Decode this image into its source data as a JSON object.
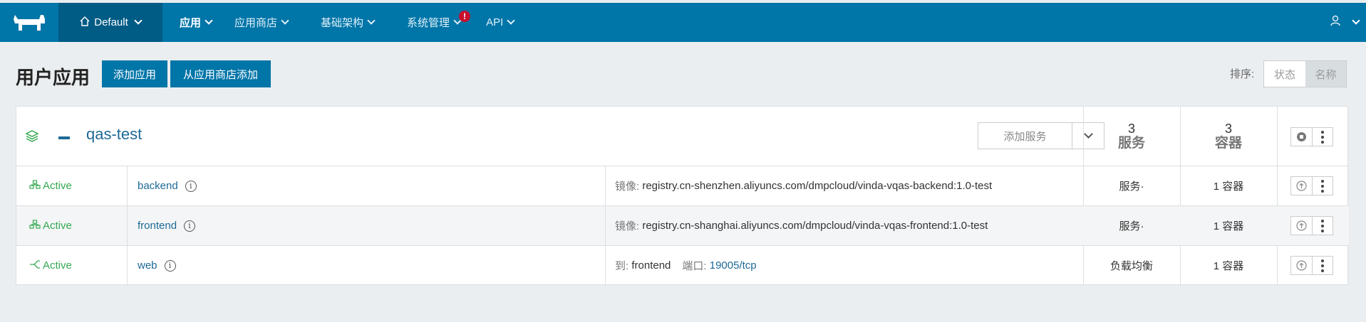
{
  "nav": {
    "environment": "Default",
    "items": [
      {
        "label": "应用",
        "active": true
      },
      {
        "label": "应用商店",
        "active": false
      },
      {
        "label": "基础架构",
        "active": false
      },
      {
        "label": "系统管理",
        "active": false,
        "alert": "!"
      },
      {
        "label": "API",
        "active": false
      }
    ]
  },
  "header": {
    "title": "用户应用",
    "add_stack": "添加应用",
    "add_from_catalog": "从应用商店添加",
    "sort_label": "排序:",
    "sort_options": [
      "状态",
      "名称"
    ],
    "sort_selected": "名称"
  },
  "stack": {
    "name": "qas-test",
    "add_service": "添加服务",
    "service_count": "3",
    "service_count_label": "服务",
    "container_count": "3",
    "container_count_label": "容器",
    "services": [
      {
        "state": "Active",
        "name": "backend",
        "detail_key": "镜像:",
        "detail_value": "registry.cn-shenzhen.aliyuncs.com/dmpcloud/vinda-vqas-backend:1.0-test",
        "kind": "服务·",
        "containers": "1 容器"
      },
      {
        "state": "Active",
        "name": "frontend",
        "detail_key": "镜像:",
        "detail_value": "registry.cn-shanghai.aliyuncs.com/dmpcloud/vinda-vqas-frontend:1.0-test",
        "kind": "服务·",
        "containers": "1 容器"
      },
      {
        "state": "Active",
        "name": "web",
        "target_key": "到:",
        "target_value": "frontend",
        "port_key": "端口:",
        "port_value": "19005/tcp",
        "kind": "负载均衡",
        "containers": "1 容器"
      }
    ]
  },
  "colors": {
    "nav": "#0075a8",
    "nav_dark": "#005b85",
    "active": "#36a852",
    "link": "#1e6996"
  }
}
